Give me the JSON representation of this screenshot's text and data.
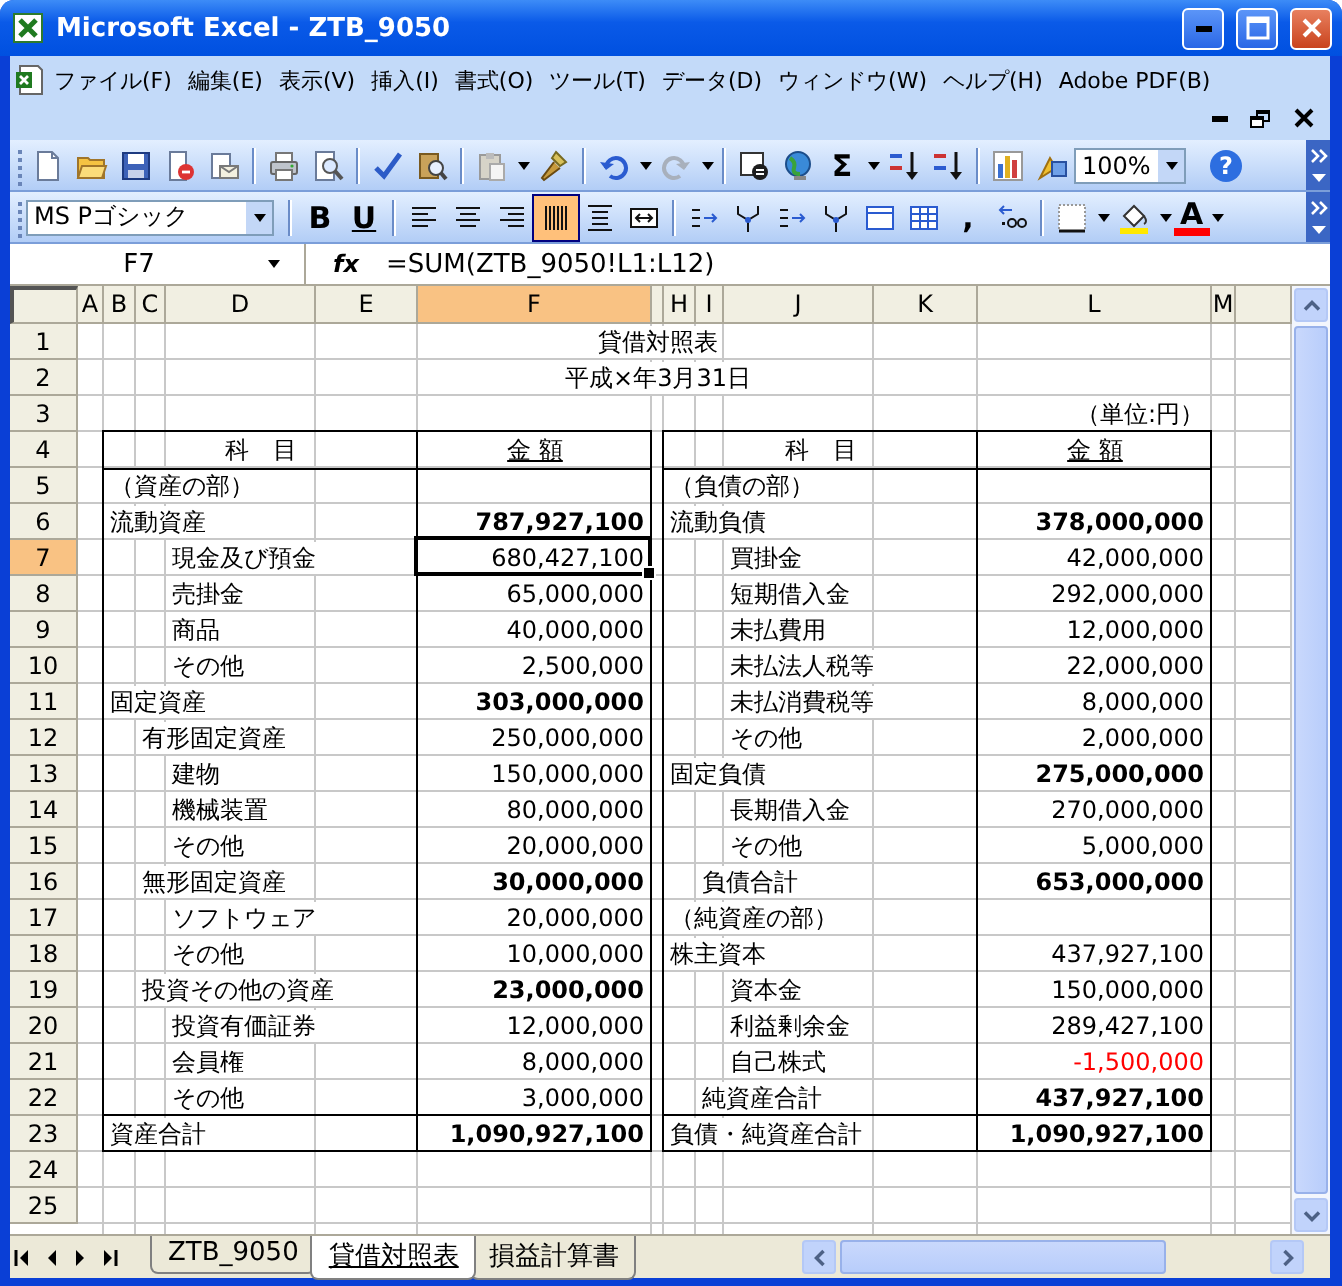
{
  "window": {
    "title": "Microsoft Excel - ZTB_9050"
  },
  "menu": [
    {
      "label": "ファイル(F)"
    },
    {
      "label": "編集(E)"
    },
    {
      "label": "表示(V)"
    },
    {
      "label": "挿入(I)"
    },
    {
      "label": "書式(O)"
    },
    {
      "label": "ツール(T)"
    },
    {
      "label": "データ(D)"
    },
    {
      "label": "ウィンドウ(W)"
    },
    {
      "label": "ヘルプ(H)"
    },
    {
      "label": "Adobe PDF(B)"
    }
  ],
  "standard_toolbar": {
    "autosum": "Σ",
    "zoom": "100%",
    "help": "?"
  },
  "formatting_toolbar": {
    "font": "MS Pゴシック",
    "bold": "B",
    "underline": "U",
    "comma": ",",
    "font_color": "A",
    "alignment": [
      {
        "kind": "left",
        "on": false
      },
      {
        "kind": "center",
        "on": false
      },
      {
        "kind": "right",
        "on": false
      },
      {
        "kind": "distributed",
        "on": true
      }
    ]
  },
  "formula_bar": {
    "name_box": "F7",
    "fx": "fx",
    "formula": "=SUM(ZTB_9050!L1:L12)"
  },
  "columns": [
    {
      "label": "A",
      "selected": false
    },
    {
      "label": "B",
      "selected": false
    },
    {
      "label": "C",
      "selected": false
    },
    {
      "label": "D",
      "selected": false
    },
    {
      "label": "E",
      "selected": false
    },
    {
      "label": "F",
      "selected": true
    },
    {
      "selected": false
    },
    {
      "label": "H",
      "selected": false
    },
    {
      "label": "I",
      "selected": false
    },
    {
      "label": "J",
      "selected": false
    },
    {
      "label": "K",
      "selected": false
    },
    {
      "label": "L",
      "selected": false
    },
    {
      "label": "M",
      "selected": false
    }
  ],
  "row_headers": [
    {
      "label": "1",
      "selected": false
    },
    {
      "label": "2",
      "selected": false
    },
    {
      "label": "3",
      "selected": false
    },
    {
      "label": "4",
      "selected": false
    },
    {
      "label": "5",
      "selected": false
    },
    {
      "label": "6",
      "selected": false
    },
    {
      "label": "7",
      "selected": true
    },
    {
      "label": "8",
      "selected": false
    },
    {
      "label": "9",
      "selected": false
    },
    {
      "label": "10",
      "selected": false
    },
    {
      "label": "11",
      "selected": false
    },
    {
      "label": "12",
      "selected": false
    },
    {
      "label": "13",
      "selected": false
    },
    {
      "label": "14",
      "selected": false
    },
    {
      "label": "15",
      "selected": false
    },
    {
      "label": "16",
      "selected": false
    },
    {
      "label": "17",
      "selected": false
    },
    {
      "label": "18",
      "selected": false
    },
    {
      "label": "19",
      "selected": false
    },
    {
      "label": "20",
      "selected": false
    },
    {
      "label": "21",
      "selected": false
    },
    {
      "label": "22",
      "selected": false
    },
    {
      "label": "23",
      "selected": false
    },
    {
      "label": "24",
      "selected": false
    },
    {
      "label": "25",
      "selected": false
    }
  ],
  "sheet": {
    "title": "貸借対照表",
    "date": "平成×年3月31日",
    "unit": "（単位:円）",
    "left_table": {
      "headers": [
        {
          "text": "科　目",
          "underline": false
        },
        {
          "text": "金 額",
          "underline": true
        }
      ],
      "rows": [
        {
          "kind": "section",
          "label": "（資産の部）"
        },
        {
          "kind": "category",
          "label": "流動資産",
          "amount": "787,927,100",
          "bold": true
        },
        {
          "kind": "item",
          "label": "現金及び預金",
          "amount": "680,427,100",
          "bold": false
        },
        {
          "kind": "item",
          "label": "売掛金",
          "amount": "65,000,000",
          "bold": false
        },
        {
          "kind": "item",
          "label": "商品",
          "amount": "40,000,000",
          "bold": false
        },
        {
          "kind": "item",
          "label": "その他",
          "amount": "2,500,000",
          "bold": false
        },
        {
          "kind": "category",
          "label": "固定資産",
          "amount": "303,000,000",
          "bold": true
        },
        {
          "kind": "subcategory",
          "label": "有形固定資産",
          "amount": "250,000,000",
          "bold": false
        },
        {
          "kind": "item",
          "label": "建物",
          "amount": "150,000,000",
          "bold": false
        },
        {
          "kind": "item",
          "label": "機械装置",
          "amount": "80,000,000",
          "bold": false
        },
        {
          "kind": "item",
          "label": "その他",
          "amount": "20,000,000",
          "bold": false
        },
        {
          "kind": "subcategory",
          "label": "無形固定資産",
          "amount": "30,000,000",
          "bold": true
        },
        {
          "kind": "item",
          "label": "ソフトウェア",
          "amount": "20,000,000",
          "bold": false
        },
        {
          "kind": "item",
          "label": "その他",
          "amount": "10,000,000",
          "bold": false
        },
        {
          "kind": "subcategory",
          "label": "投資その他の資産",
          "amount": "23,000,000",
          "bold": true
        },
        {
          "kind": "item",
          "label": "投資有価証券",
          "amount": "12,000,000",
          "bold": false
        },
        {
          "kind": "item",
          "label": "会員権",
          "amount": "8,000,000",
          "bold": false
        },
        {
          "kind": "item",
          "label": "その他",
          "amount": "3,000,000",
          "bold": false
        },
        {
          "kind": "total",
          "label": "資産合計",
          "amount": "1,090,927,100",
          "bold": true
        }
      ]
    },
    "right_table": {
      "headers": [
        {
          "text": "科　目",
          "underline": false
        },
        {
          "text": "金 額",
          "underline": true
        }
      ],
      "rows": [
        {
          "kind": "section",
          "label": "（負債の部）"
        },
        {
          "kind": "category",
          "label": "流動負債",
          "amount": "378,000,000",
          "bold": true
        },
        {
          "kind": "item",
          "label": "買掛金",
          "amount": "42,000,000",
          "bold": false
        },
        {
          "kind": "item",
          "label": "短期借入金",
          "amount": "292,000,000",
          "bold": false
        },
        {
          "kind": "item",
          "label": "未払費用",
          "amount": "12,000,000",
          "bold": false
        },
        {
          "kind": "item",
          "label": "未払法人税等",
          "amount": "22,000,000",
          "bold": false
        },
        {
          "kind": "item",
          "label": "未払消費税等",
          "amount": "8,000,000",
          "bold": false
        },
        {
          "kind": "item",
          "label": "その他",
          "amount": "2,000,000",
          "bold": false
        },
        {
          "kind": "category",
          "label": "固定負債",
          "amount": "275,000,000",
          "bold": true
        },
        {
          "kind": "item",
          "label": "長期借入金",
          "amount": "270,000,000",
          "bold": false
        },
        {
          "kind": "item",
          "label": "その他",
          "amount": "5,000,000",
          "bold": false
        },
        {
          "kind": "subtotal",
          "label": "負債合計",
          "amount": "653,000,000",
          "bold": true
        },
        {
          "kind": "section",
          "label": "（純資産の部）"
        },
        {
          "kind": "category",
          "label": "株主資本",
          "amount": "437,927,100",
          "bold": false
        },
        {
          "kind": "item",
          "label": "資本金",
          "amount": "150,000,000",
          "bold": false
        },
        {
          "kind": "item",
          "label": "利益剰余金",
          "amount": "289,427,100",
          "bold": false
        },
        {
          "kind": "item",
          "label": "自己株式",
          "amount": "-1,500,000",
          "bold": false,
          "negative": true
        },
        {
          "kind": "subtotal",
          "label": "純資産合計",
          "amount": "437,927,100",
          "bold": true
        },
        {
          "kind": "total",
          "label": "負債・純資産合計",
          "amount": "1,090,927,100",
          "bold": true
        }
      ]
    }
  },
  "sheet_tabs": [
    {
      "label": "ZTB_9050",
      "selected": false
    },
    {
      "label": "貸借対照表",
      "selected": true
    },
    {
      "label": "損益計算書",
      "selected": false
    }
  ]
}
